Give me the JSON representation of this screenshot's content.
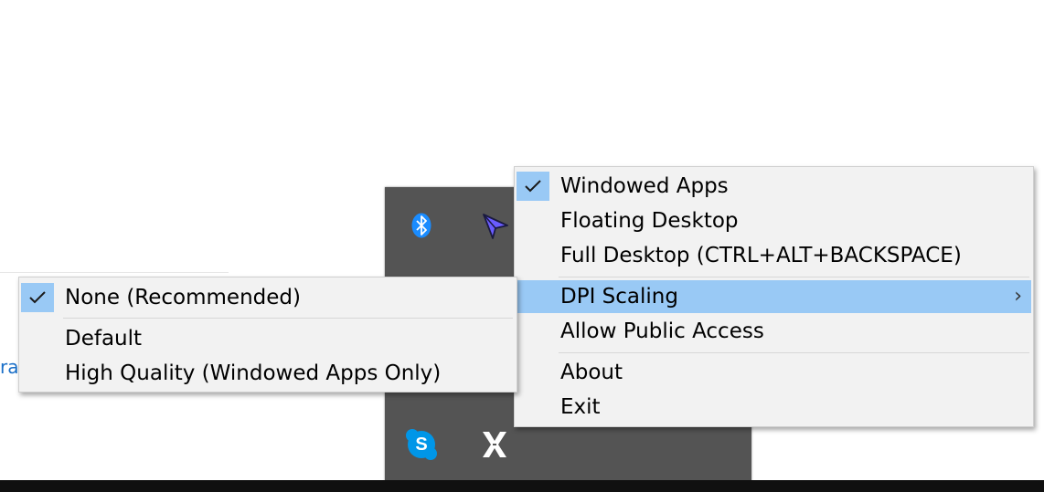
{
  "background": {
    "link_fragment": "ra"
  },
  "tray": {
    "icons": [
      {
        "name": "bluetooth-icon"
      },
      {
        "name": "paper-plane-icon"
      },
      {
        "name": "skype-icon",
        "glyph": "S"
      },
      {
        "name": "x-app-icon"
      }
    ]
  },
  "main_menu": {
    "items": {
      "windowed_apps": "Windowed Apps",
      "floating_desktop": "Floating Desktop",
      "full_desktop": "Full Desktop (CTRL+ALT+BACKSPACE)",
      "dpi_scaling": "DPI Scaling",
      "allow_public_access": "Allow Public Access",
      "about": "About",
      "exit": "Exit"
    },
    "checked_item": "windowed_apps",
    "highlighted_item": "dpi_scaling",
    "submenu_arrow": "›"
  },
  "submenu": {
    "items": {
      "none": "None (Recommended)",
      "default": "Default",
      "high_quality": "High Quality (Windowed Apps Only)"
    },
    "checked_item": "none"
  },
  "colors": {
    "highlight": "#99c9f5",
    "menu_bg": "#f2f2f2",
    "tray_bg": "#545454",
    "taskbar": "#101010",
    "bluetooth": "#1a8cff",
    "skype": "#0096e8"
  }
}
